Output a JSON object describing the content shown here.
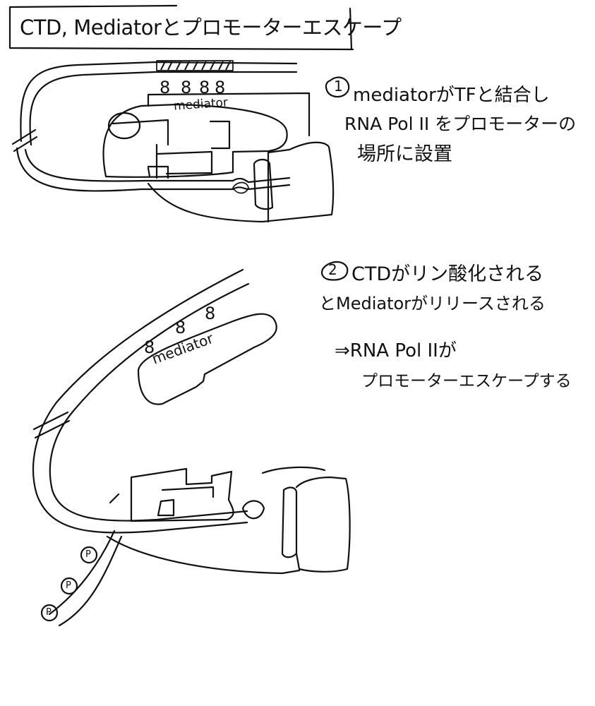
{
  "title": "CTD, Mediatorとプロモーターエスケープ",
  "step1": {
    "number": "1",
    "line1": "mediatorがTFと結合し",
    "line2": "RNA Pol II をプロモーターの",
    "line3": "場所に設置",
    "mediator_label": "mediator"
  },
  "step2": {
    "number": "2",
    "line1": "CTDがリン酸化される",
    "line2": "とMediatorがリリースされる",
    "line3": "⇒RNA Pol IIが",
    "line4": "プロモーターエスケープする",
    "mediator_label": "mediator",
    "phospho_label": "P"
  }
}
